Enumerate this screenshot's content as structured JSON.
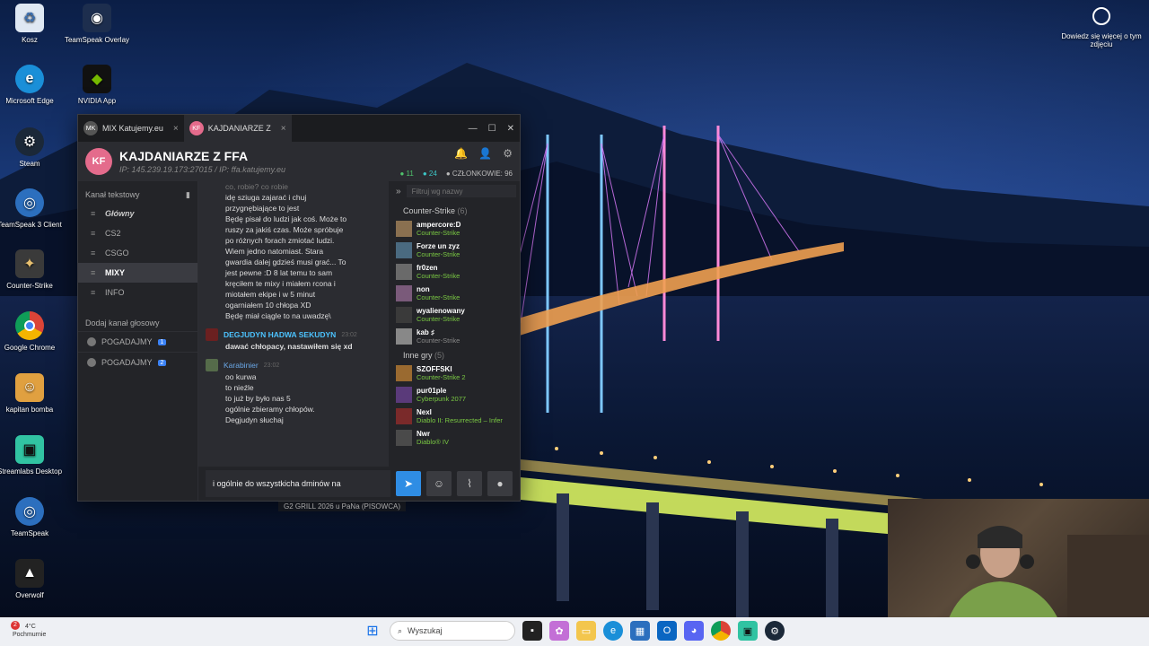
{
  "desktop": {
    "icons": [
      {
        "label": "Kosz",
        "icon": "recycle-bin-icon"
      },
      {
        "label": "TeamSpeak Overlay",
        "icon": "teamspeak-overlay-icon"
      },
      {
        "label": "Microsoft Edge",
        "icon": "edge-icon"
      },
      {
        "label": "NVIDIA App",
        "icon": "nvidia-icon"
      },
      {
        "label": "Steam",
        "icon": "steam-icon"
      },
      {
        "label": "TeamSpeak 3 Client",
        "icon": "teamspeak3-icon"
      },
      {
        "label": "Counter-Strike",
        "icon": "counter-strike-icon"
      },
      {
        "label": "Google Chrome",
        "icon": "chrome-icon"
      },
      {
        "label": "kapitan bomba",
        "icon": "kapitan-bomba-icon"
      },
      {
        "label": "Streamlabs Desktop",
        "icon": "streamlabs-icon"
      },
      {
        "label": "TeamSpeak",
        "icon": "teamspeak-icon"
      },
      {
        "label": "Overwolf",
        "icon": "overwolf-icon"
      }
    ],
    "notice": "Dowiedz się więcej o tym zdjęciu"
  },
  "window": {
    "tabs": [
      {
        "avatar": "MK",
        "label": "MIX Katujemy.eu"
      },
      {
        "avatar": "KF",
        "label": "KAJDANIARZE Z"
      }
    ],
    "server": {
      "title": "KAJDANIARZE Z FFA",
      "subtitle": "IP: 145.239.19.173:27015 / IP: ffa.katujemy.eu",
      "online": "11",
      "in_game": "24",
      "members": "CZŁONKOWIE: 96"
    },
    "sidebar": {
      "text_header": "Kanał tekstowy",
      "channels": [
        {
          "label": "Główny",
          "sym": "≡"
        },
        {
          "label": "CS2",
          "sym": "≡"
        },
        {
          "label": "CSGO",
          "sym": "≡"
        },
        {
          "label": "MIXY",
          "sym": "≡"
        },
        {
          "label": "INFO",
          "sym": "≡"
        }
      ],
      "voice_header": "Dodaj kanał głosowy",
      "voice": [
        {
          "label": "POGADAJMY",
          "badge": "1"
        },
        {
          "label": "POGADAJMY",
          "badge": "2"
        }
      ]
    },
    "chat": {
      "lines_top": [
        "co, robie? co robie",
        "idę sziuga zajarać i chuj",
        "przygnębiające to jest",
        "Będę pisał do ludzi jak coś. Może to",
        "ruszy za jakiś czas. Może spróbuje",
        "po różnych forach zmiotać ludzi.",
        "Wiem jedno natomiast. Stara",
        "gwardia dalej gdzieś musi grać... To",
        "jest pewne :D 8 lat temu to sam",
        "kręciłem te mixy i miałem rcona i",
        "miotałem ekipe i w 5 minut",
        "ogarniałem 10 chłopa XD",
        "Będę miał ciągle to na uwadzę\\"
      ],
      "msg2": {
        "author": "DEGJUDYN HADWA SEKUDYN",
        "time": "23:02",
        "lines": [
          "dawać chłopacy, nastawiłem się xd"
        ]
      },
      "msg3": {
        "author": "Karabinier",
        "time": "23:02",
        "lines": [
          "oo kurwa",
          "to nieźle",
          "to już by było nas 5",
          "ogólnie zbieramy chłopów.",
          "Degjudyn słuchaj"
        ]
      }
    },
    "members": {
      "search_placeholder": "Filtruj wg nazwy",
      "group1": {
        "label": "Counter-Strike",
        "count": "(6)"
      },
      "list1": [
        {
          "name": "ampercore:D",
          "status": "Counter-Strike"
        },
        {
          "name": "Forze un zyz",
          "status": "Counter-Strike"
        },
        {
          "name": "fr0zen",
          "status": "Counter-Strike"
        },
        {
          "name": "non",
          "status": "Counter-Strike"
        },
        {
          "name": "wyalienowany",
          "status": "Counter-Strike"
        },
        {
          "name": "kab ♯",
          "status": "Counter-Strike"
        }
      ],
      "group2": {
        "label": "Inne gry",
        "count": "(5)"
      },
      "list2": [
        {
          "name": "SZOFFSKI",
          "status": "Counter-Strike 2"
        },
        {
          "name": "pur01ple",
          "status": "Cyberpunk 2077"
        },
        {
          "name": "Nexl",
          "status": "Diablo II: Resurrected – Infer"
        },
        {
          "name": "Nwr",
          "status": "Diablo® IV"
        }
      ]
    },
    "composer": {
      "value": "i ogólnie do wszystkicha dminów na"
    }
  },
  "overlay_text": "G2  GRILL 2026 u PaNa (PISOWCA)",
  "taskbar": {
    "weather_temp": "4°C",
    "weather_desc": "Pochmurnie",
    "weather_badge": "2",
    "search_label": "Wyszukaj"
  }
}
